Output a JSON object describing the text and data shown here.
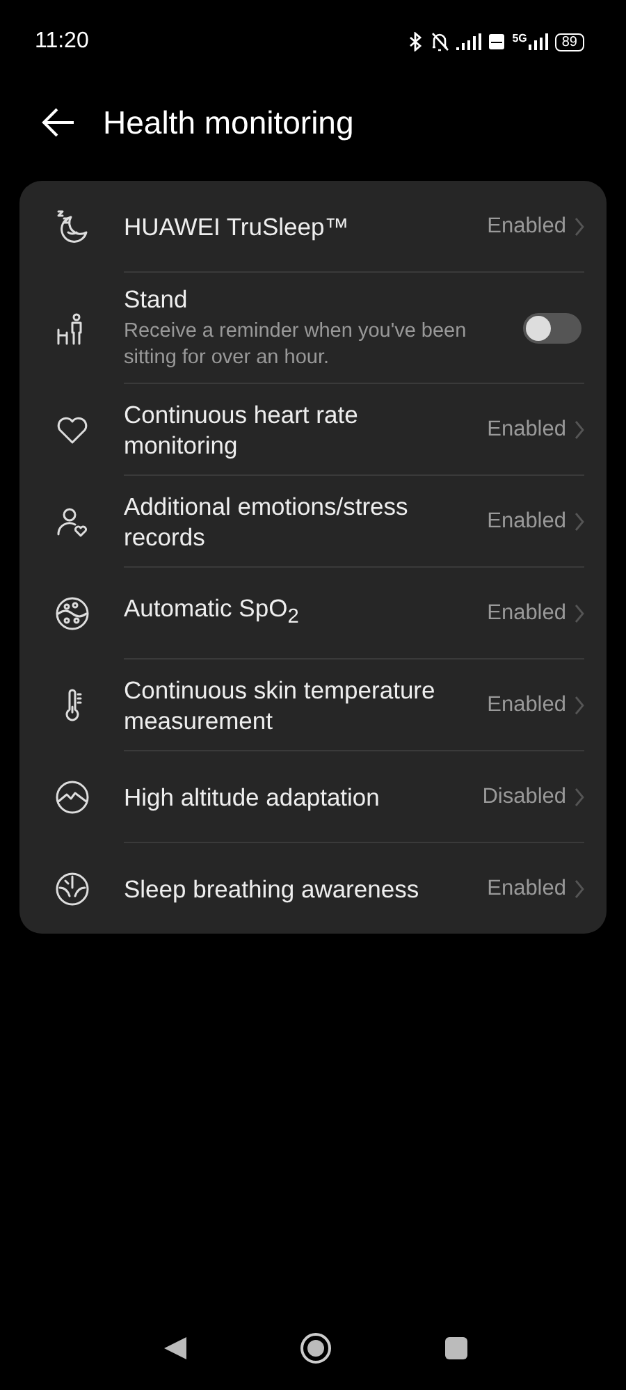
{
  "status_bar": {
    "time": "11:20",
    "network": "5G",
    "battery": "89"
  },
  "header": {
    "title": "Health monitoring"
  },
  "settings": [
    {
      "kind": "link",
      "title": "HUAWEI TruSleep™",
      "value": "Enabled"
    },
    {
      "kind": "toggle",
      "title": "Stand",
      "subtitle": "Receive a reminder when you've been sitting for over an hour.",
      "on": false
    },
    {
      "kind": "link",
      "title": "Continuous heart rate monitoring",
      "value": "Enabled"
    },
    {
      "kind": "link",
      "title": "Additional emotions/stress records",
      "value": "Enabled"
    },
    {
      "kind": "link",
      "title": "Automatic SpO$_{2}$",
      "value": "Enabled"
    },
    {
      "kind": "link",
      "title": "Continuous skin temperature measurement",
      "value": "Enabled"
    },
    {
      "kind": "link",
      "title": "High altitude adaptation",
      "value": "Disabled"
    },
    {
      "kind": "link",
      "title": "Sleep breathing awareness",
      "value": "Enabled"
    }
  ]
}
